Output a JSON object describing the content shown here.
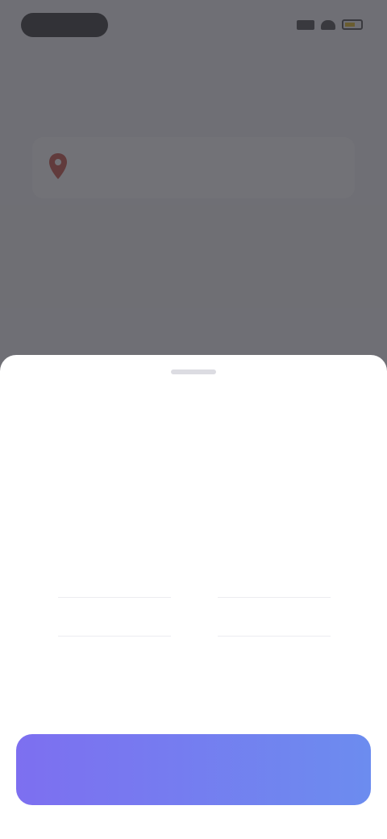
{
  "status_bar": {
    "time": "",
    "battery_color": "#e0b400"
  },
  "page": {
    "title": "",
    "row": {
      "label": "",
      "value": ""
    },
    "link": "",
    "section_label": "",
    "section_link": ""
  },
  "sheet": {
    "title": "",
    "left_header": "",
    "right_header": "",
    "left_items": [
      "",
      "",
      "",
      "",
      ""
    ],
    "right_items": [
      "",
      "",
      "",
      "",
      ""
    ],
    "confirm_label": ""
  },
  "colors": {
    "accent": "#6666ee",
    "button_start": "#7d6ff0",
    "button_end": "#6c8cef",
    "overlay": "rgba(60,60,66,0.72)"
  }
}
